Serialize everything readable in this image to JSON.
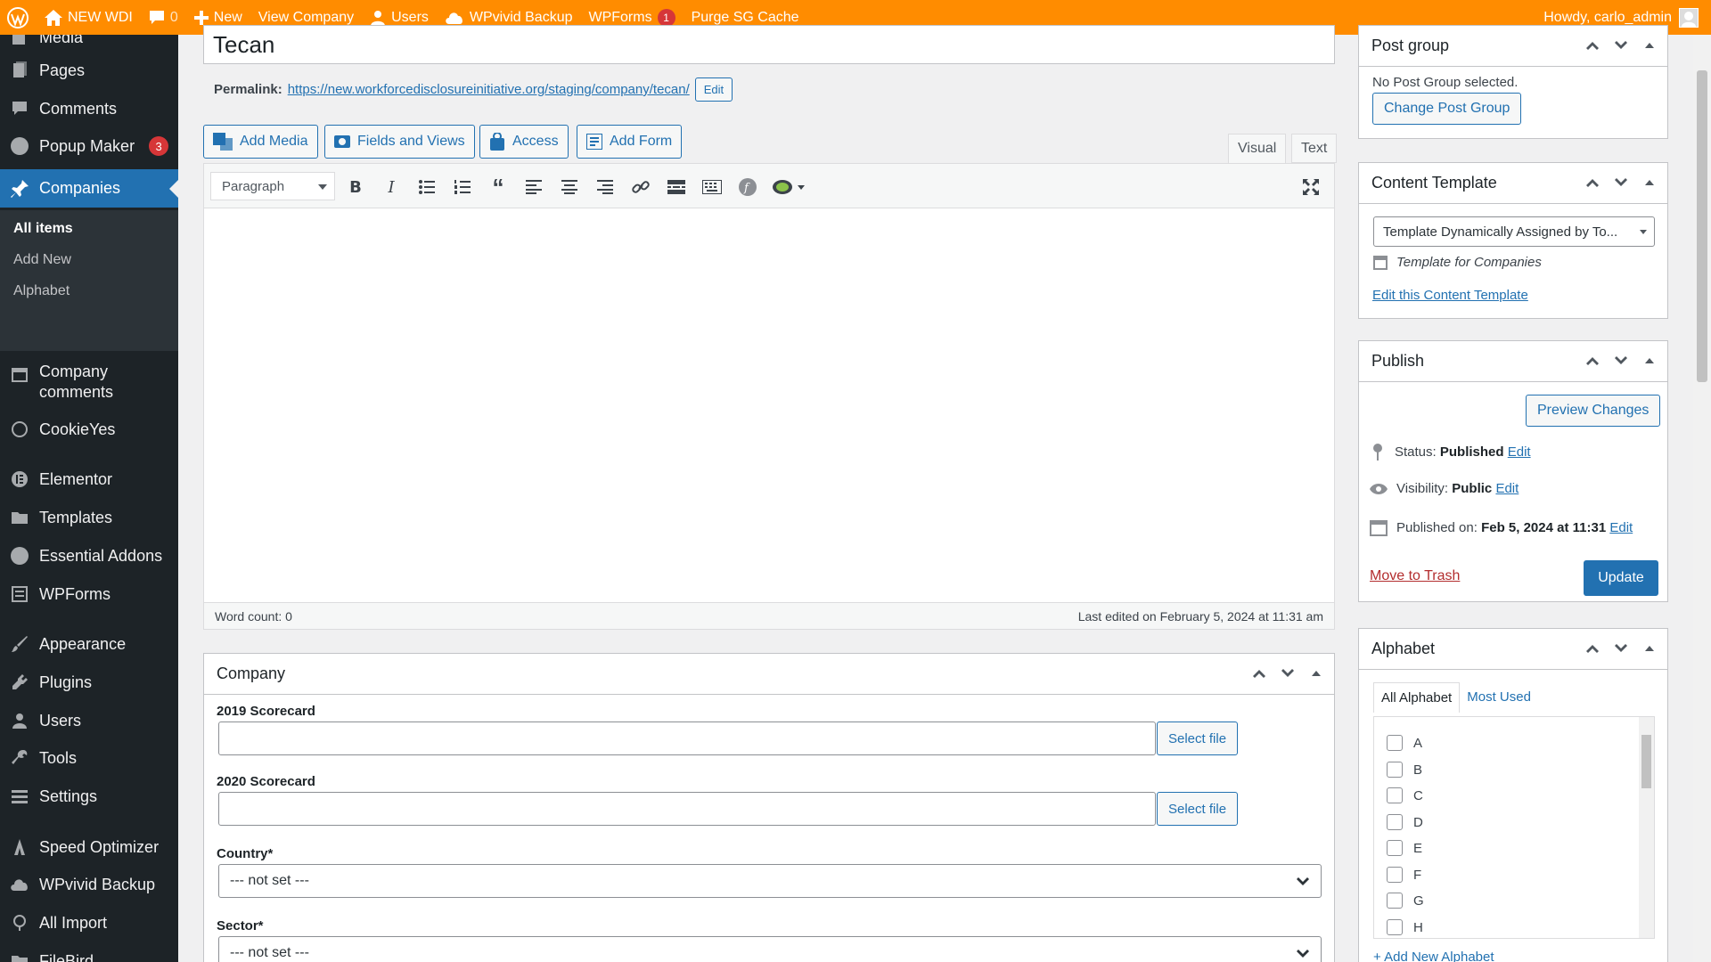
{
  "adminbar": {
    "site_name": "NEW WDI",
    "comments_count": "0",
    "new_label": "New",
    "view_label": "View Company",
    "users_label": "Users",
    "wpvivid_label": "WPvivid Backup",
    "wpforms_label": "WPForms",
    "wpforms_badge": "1",
    "purge_label": "Purge SG Cache",
    "howdy": "Howdy, carlo_admin"
  },
  "sidebar": {
    "items": [
      {
        "label": "Media",
        "icon": "media-icon"
      },
      {
        "label": "Pages",
        "icon": "pages-icon"
      },
      {
        "label": "Comments",
        "icon": "comments-icon"
      },
      {
        "label": "Popup Maker",
        "icon": "popup-icon",
        "badge": "3"
      },
      {
        "label": "Companies",
        "icon": "pin-icon"
      },
      {
        "label": "Company comments",
        "icon": "calendar-icon"
      },
      {
        "label": "CookieYes",
        "icon": "cookie-icon"
      },
      {
        "label": "Elementor",
        "icon": "elementor-icon"
      },
      {
        "label": "Templates",
        "icon": "folder-icon"
      },
      {
        "label": "Essential Addons",
        "icon": "ea-icon"
      },
      {
        "label": "WPForms",
        "icon": "forms-icon"
      },
      {
        "label": "Appearance",
        "icon": "brush-icon"
      },
      {
        "label": "Plugins",
        "icon": "plugin-icon"
      },
      {
        "label": "Users",
        "icon": "user-icon"
      },
      {
        "label": "Tools",
        "icon": "wrench-icon"
      },
      {
        "label": "Settings",
        "icon": "settings-icon"
      },
      {
        "label": "Speed Optimizer",
        "icon": "speed-icon"
      },
      {
        "label": "WPvivid Backup",
        "icon": "cloud-icon"
      },
      {
        "label": "All Import",
        "icon": "import-icon"
      },
      {
        "label": "FileBird",
        "icon": "folder-icon"
      }
    ],
    "submenu": [
      "All items",
      "Add New",
      "Alphabet"
    ]
  },
  "post": {
    "title": "Tecan",
    "permalink_label": "Permalink:",
    "permalink_url": "https://new.workforcedisclosureinitiative.org/staging/company/tecan/",
    "permalink_edit": "Edit"
  },
  "media_buttons": [
    "Add Media",
    "Fields and Views",
    "Access",
    "Add Form"
  ],
  "editor": {
    "tab_visual": "Visual",
    "tab_text": "Text",
    "format": "Paragraph",
    "word_count": "Word count: 0",
    "last_edited": "Last edited on February 5, 2024 at 11:31 am"
  },
  "company_box": {
    "title": "Company",
    "scorecard_2019_label": "2019 Scorecard",
    "scorecard_2020_label": "2020 Scorecard",
    "select_file": "Select file",
    "country_label": "Country*",
    "country_value": "--- not set ---",
    "sector_label": "Sector*",
    "sector_value": "--- not set ---"
  },
  "post_group": {
    "title": "Post group",
    "status": "No Post Group selected.",
    "change_button": "Change Post Group"
  },
  "content_template": {
    "title": "Content Template",
    "select_value": "Template Dynamically Assigned by To...",
    "template_name": "Template for Companies",
    "edit_link": "Edit this Content Template"
  },
  "publish": {
    "title": "Publish",
    "preview_button": "Preview Changes",
    "status_label": "Status:",
    "status_value": "Published",
    "visibility_label": "Visibility:",
    "visibility_value": "Public",
    "published_label": "Published on:",
    "published_value": "Feb 5, 2024 at 11:31",
    "edit": "Edit",
    "trash": "Move to Trash",
    "update": "Update"
  },
  "alphabet": {
    "title": "Alphabet",
    "tab_all": "All Alphabet",
    "tab_used": "Most Used",
    "letters": [
      "A",
      "B",
      "C",
      "D",
      "E",
      "F",
      "G",
      "H"
    ],
    "add_new": "+ Add New Alphabet"
  },
  "colors": {
    "admin_bar": "#ff8c00",
    "sidebar": "#1d2327",
    "accent": "#2271b1"
  }
}
